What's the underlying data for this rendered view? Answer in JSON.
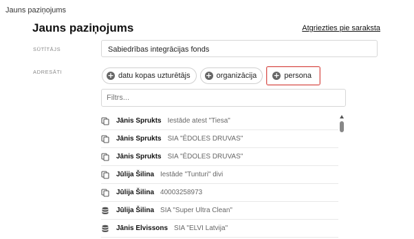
{
  "breadcrumb": "Jauns paziņojums",
  "page_title": "Jauns paziņojums",
  "back_link": "Atgriezties pie saraksta",
  "sender": {
    "label": "SŪTĪTĀJS",
    "value": "Sabiedrības integrācijas fonds"
  },
  "recipients": {
    "label": "ADRESĀTI",
    "chips": [
      {
        "label": "datu kopas uzturētājs",
        "icon": "plus-circle-icon",
        "selected": false
      },
      {
        "label": "organizācija",
        "icon": "plus-circle-icon",
        "selected": false
      },
      {
        "label": "persona",
        "icon": "plus-circle-icon",
        "selected": true
      }
    ]
  },
  "filter": {
    "placeholder": "Filtrs..."
  },
  "list": [
    {
      "name": "Jānis Sprukts",
      "org": "Iestāde atest \"Tiesa\"",
      "icon": "copy-icon"
    },
    {
      "name": "Jānis Sprukts",
      "org": "SIA \"ĒDOLES DRUVAS\"",
      "icon": "copy-icon"
    },
    {
      "name": "Jānis Sprukts",
      "org": "SIA \"ĒDOLES DRUVAS\"",
      "icon": "copy-icon"
    },
    {
      "name": "Jūlija Šilina",
      "org": "Iestāde \"Tunturi\" divi",
      "icon": "copy-icon"
    },
    {
      "name": "Jūlija Šilina",
      "org": "40003258973",
      "icon": "copy-icon"
    },
    {
      "name": "Jūlija Šilina",
      "org": "SIA \"Super Ultra Clean\"",
      "icon": "database-icon"
    },
    {
      "name": "Jānis Elvissons",
      "org": "SIA \"ELVI Latvija\"",
      "icon": "database-icon"
    }
  ]
}
